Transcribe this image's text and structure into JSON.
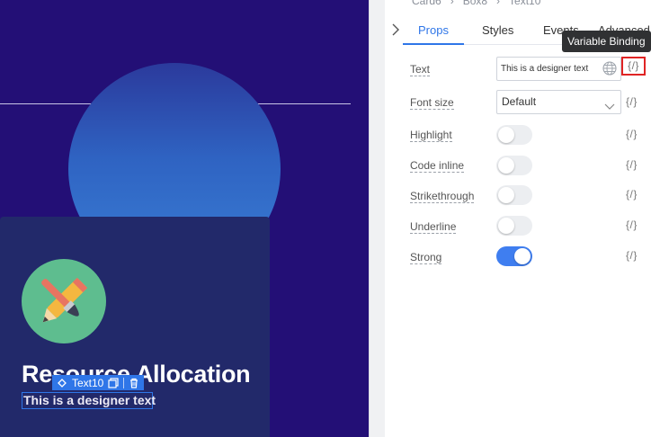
{
  "colors": {
    "canvas_bg": "#230f76",
    "accent": "#2f76e8",
    "highlight_border": "#e02424",
    "switch_on": "#3f7ef0"
  },
  "canvas": {
    "card_title": "Resource Allocation",
    "card_text": "This is a designer text",
    "selection_tag": {
      "label": "Text10",
      "icons": [
        "component-icon",
        "copy-icon",
        "trash-icon"
      ]
    }
  },
  "breadcrumb": [
    "Card6",
    "Box8",
    "Text10"
  ],
  "tabs": [
    "Props",
    "Styles",
    "Events",
    "Advanced"
  ],
  "active_tab": "Props",
  "tooltip": "Variable Binding",
  "binding_label": "{/}",
  "props": {
    "text": {
      "label": "Text",
      "value": "This is a designer text"
    },
    "font_size": {
      "label": "Font size",
      "value": "Default"
    },
    "highlight": {
      "label": "Highlight",
      "on": false
    },
    "code_inline": {
      "label": "Code inline",
      "on": false
    },
    "strikethrough": {
      "label": "Strikethrough",
      "on": false
    },
    "underline": {
      "label": "Underline",
      "on": false
    },
    "strong": {
      "label": "Strong",
      "on": true
    }
  }
}
